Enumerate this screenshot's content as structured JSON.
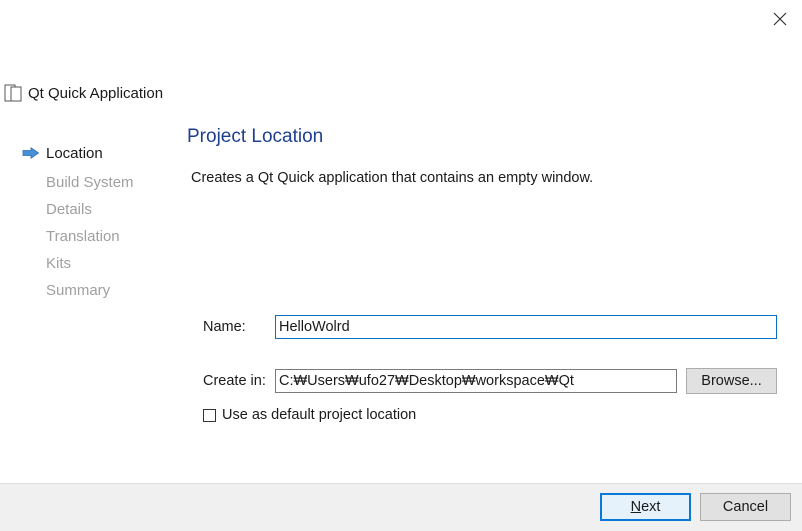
{
  "window": {
    "close_icon": "close-icon"
  },
  "wizard": {
    "title": "Qt Quick Application",
    "steps": [
      {
        "label": "Location",
        "active": true
      },
      {
        "label": "Build System",
        "active": false
      },
      {
        "label": "Details",
        "active": false
      },
      {
        "label": "Translation",
        "active": false
      },
      {
        "label": "Kits",
        "active": false
      },
      {
        "label": "Summary",
        "active": false
      }
    ]
  },
  "page": {
    "title": "Project Location",
    "description": "Creates a Qt Quick application that contains an empty window."
  },
  "form": {
    "name_label": "Name:",
    "name_value": "HelloWolrd",
    "create_in_label": "Create in:",
    "create_in_value": "C:₩Users₩ufo27₩Desktop₩workspace₩Qt",
    "browse_label": "Browse...",
    "default_location_label": "Use as default project location",
    "default_location_checked": false
  },
  "footer": {
    "next_label_accel": "N",
    "next_label_rest": "ext",
    "cancel_label": "Cancel"
  },
  "colors": {
    "accent": "#0a78d7",
    "title_blue": "#1f3f8f",
    "inactive_step": "#a0a0a0"
  }
}
